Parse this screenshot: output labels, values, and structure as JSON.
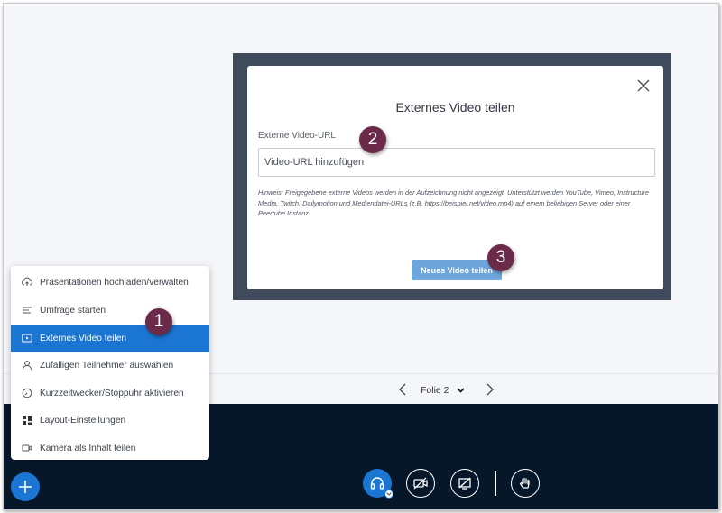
{
  "menu": {
    "items": [
      {
        "label": "Präsentationen hochladen/verwalten",
        "icon": "upload-cloud-icon",
        "active": false
      },
      {
        "label": "Umfrage starten",
        "icon": "poll-icon",
        "active": false
      },
      {
        "label": "Externes Video teilen",
        "icon": "external-video-icon",
        "active": true
      },
      {
        "label": "Zufälligen Teilnehmer auswählen",
        "icon": "user-icon",
        "active": false
      },
      {
        "label": "Kurzzeitwecker/Stoppuhr aktivieren",
        "icon": "timer-icon",
        "active": false
      },
      {
        "label": "Layout-Einstellungen",
        "icon": "layout-grid-icon",
        "active": false
      },
      {
        "label": "Kamera als Inhalt teilen",
        "icon": "camera-icon",
        "active": false
      }
    ]
  },
  "modal": {
    "title": "Externes Video teilen",
    "url_label": "Externe Video-URL",
    "url_placeholder": "Video-URL hinzufügen",
    "url_value": "",
    "hint": "Hinweis: Freigegebene externe Videos werden in der Aufzeichnung nicht angezeigt. Unterstützt werden YouTube, Vimeo, Instructure Media, Twitch, Dailymotion und Mediendatei-URLs (z.B. https://beispiel.net/video.mp4) auf einem beliebigen Server oder einer Peertube Instanz.",
    "share_button": "Neues Video teilen"
  },
  "slide_nav": {
    "current": "Folie 2"
  },
  "badges": [
    "1",
    "2",
    "3"
  ],
  "colors": {
    "accent": "#1b76d3",
    "badge": "#6b2a4a",
    "bottom_bar": "#06172a",
    "button_disabled": "#6ea6dc"
  }
}
